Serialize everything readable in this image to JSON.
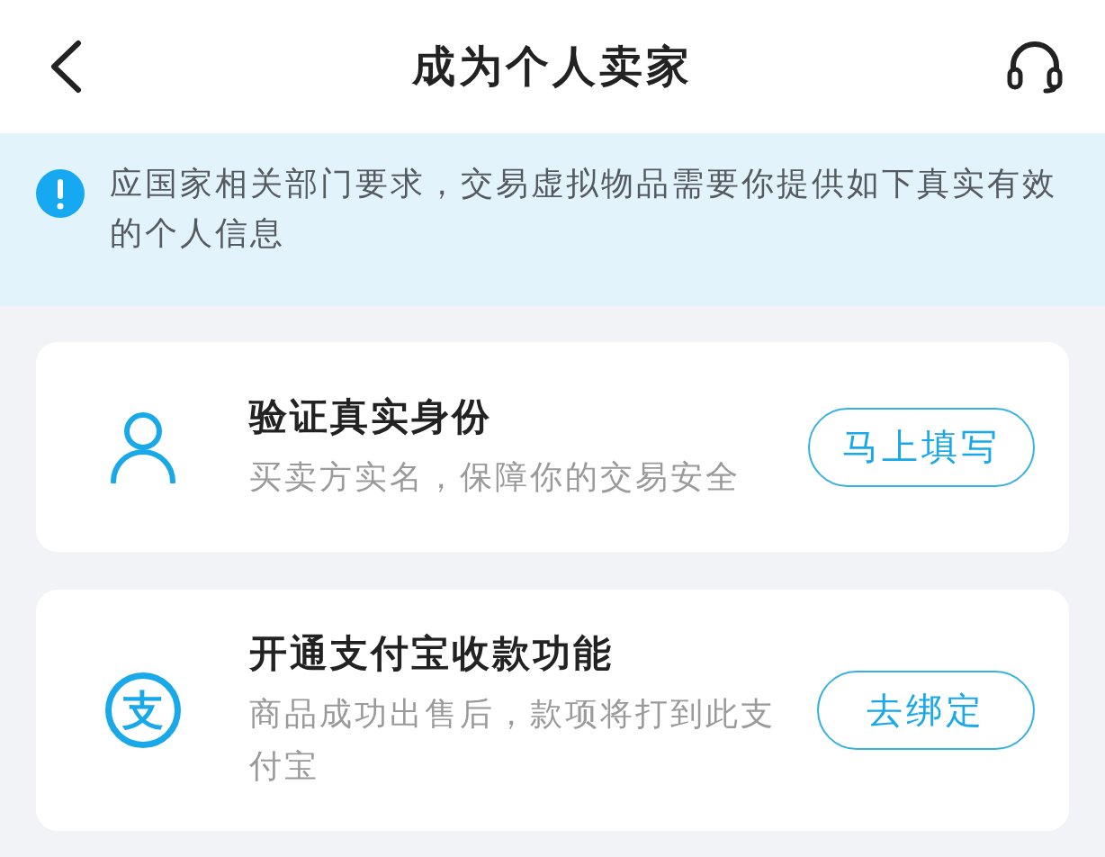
{
  "header": {
    "title": "成为个人卖家"
  },
  "notice": {
    "text": "应国家相关部门要求，交易虚拟物品需要你提供如下真实有效的个人信息"
  },
  "steps": [
    {
      "kind": "identity",
      "title": "验证真实身份",
      "subtitle": "买卖方实名，保障你的交易安全",
      "button": "马上填写"
    },
    {
      "kind": "payment",
      "logo_text": "支",
      "title": "开通支付宝收款功能",
      "subtitle": "商品成功出售后，款项将打到此支付宝",
      "button": "去绑定"
    }
  ]
}
